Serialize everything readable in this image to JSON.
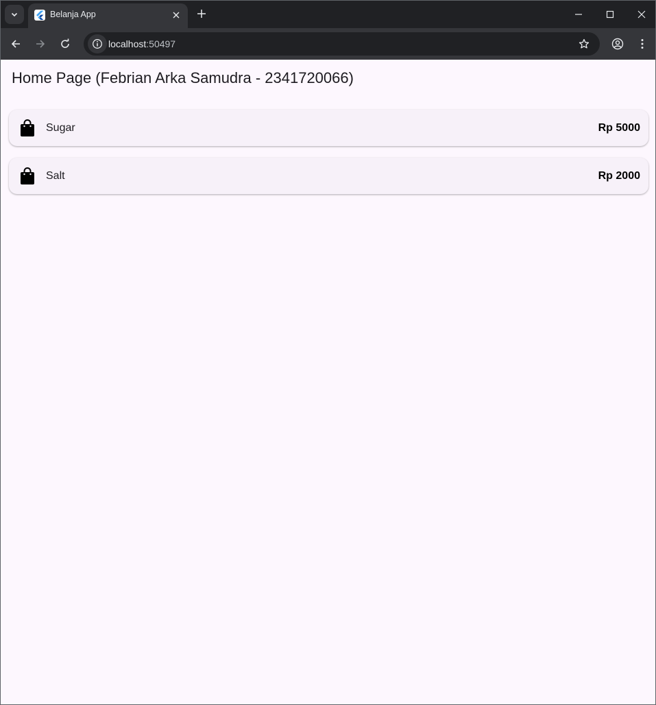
{
  "browser": {
    "tab": {
      "title": "Belanja App",
      "favicon": "flutter-icon"
    },
    "controls": {
      "tab_search_icon": "chevron-down-icon",
      "tab_close_icon": "close-icon",
      "new_tab_icon": "plus-icon",
      "minimize_icon": "minimize-icon",
      "maximize_icon": "maximize-icon",
      "close_window_icon": "close-icon"
    },
    "toolbar": {
      "back_icon": "arrow-left-icon",
      "forward_icon": "arrow-right-icon",
      "reload_icon": "reload-icon",
      "site_info_icon": "info-icon",
      "url_host": "localhost",
      "url_port": ":50497",
      "bookmark_icon": "star-icon",
      "profile_icon": "account-circle-icon",
      "menu_icon": "more-vert-icon"
    }
  },
  "app": {
    "title": "Home Page (Febrian Arka Samudra - 2341720066)",
    "items": [
      {
        "icon": "shopping-bag-icon",
        "name": "Sugar",
        "price": "Rp 5000"
      },
      {
        "icon": "shopping-bag-icon",
        "name": "Salt",
        "price": "Rp 2000"
      }
    ]
  },
  "colors": {
    "page_background": "#fdf7fe",
    "card_background": "#f7f1f9",
    "browser_frame": "#202124",
    "browser_toolbar": "#35363a"
  }
}
